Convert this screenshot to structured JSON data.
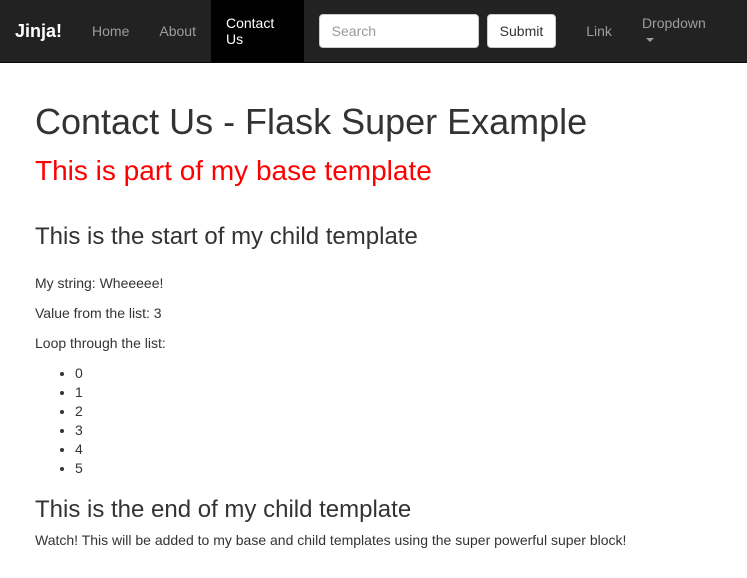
{
  "navbar": {
    "brand": "Jinja!",
    "items": [
      {
        "label": "Home",
        "active": false
      },
      {
        "label": "About",
        "active": false
      },
      {
        "label": "Contact Us",
        "active": true
      }
    ],
    "search_placeholder": "Search",
    "submit_label": "Submit",
    "right_items": [
      {
        "label": "Link"
      },
      {
        "label": "Dropdown"
      }
    ]
  },
  "page": {
    "heading": "Contact Us - Flask Super Example",
    "base_notice": "This is part of my base template",
    "child_start_heading": "This is the start of my child template",
    "my_string_line": "My string: Wheeeee!",
    "value_from_list_line": "Value from the list: 3",
    "loop_intro": "Loop through the list:",
    "list_items": [
      "0",
      "1",
      "2",
      "3",
      "4",
      "5"
    ],
    "child_end_heading": "This is the end of my child template",
    "footer_line": "Watch! This will be added to my base and child templates using the super powerful super block!"
  }
}
